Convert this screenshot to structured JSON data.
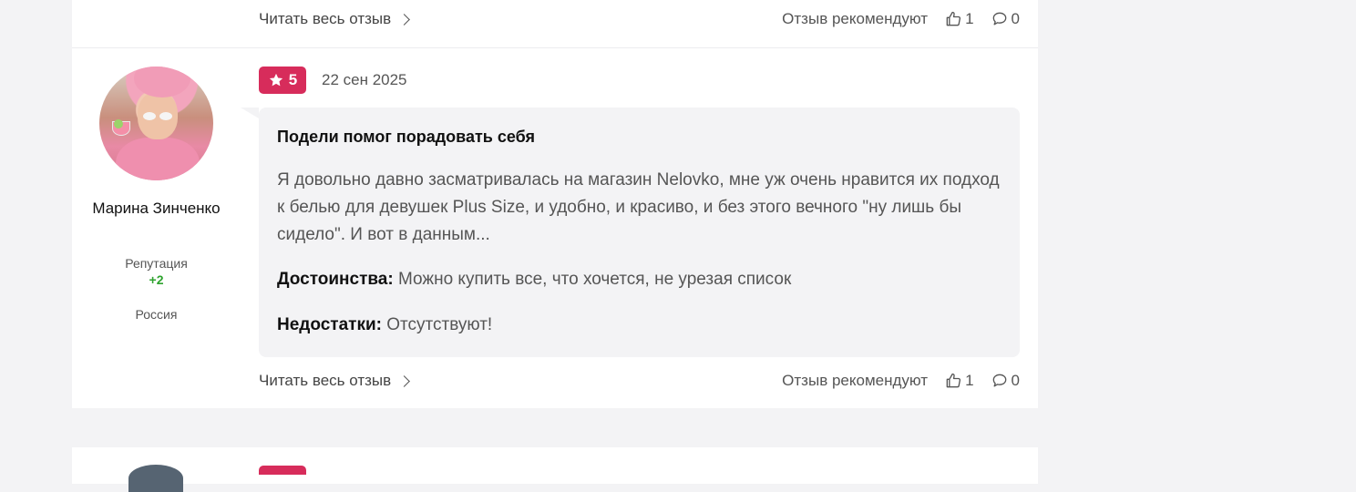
{
  "colors": {
    "accent": "#d72c5b",
    "reputation": "#2ea32e",
    "bubble": "#f3f3f5"
  },
  "prev_review": {
    "read_more": "Читать весь отзыв",
    "recommend_label": "Отзыв рекомендуют",
    "likes": "1",
    "comments": "0"
  },
  "review": {
    "author": {
      "name": "Марина Зинченко",
      "reputation_label": "Репутация",
      "reputation_value": "+2",
      "country": "Россия"
    },
    "rating": "5",
    "date": "22 сен 2025",
    "title": "Подели помог порадовать себя",
    "text": "Я довольно давно засматривалась на магазин Nelovko, мне уж очень нравится их подход к белью для девушек Plus Size, и удобно, и красиво, и без этого вечного \"ну лишь бы сидело\". И вот в данным...",
    "pros_label": "Достоинства:",
    "pros": "Можно купить все, что хочется, не урезая список",
    "cons_label": "Недостатки:",
    "cons": "Отсутствуют!",
    "read_more": "Читать весь отзыв",
    "recommend_label": "Отзыв рекомендуют",
    "likes": "1",
    "comments": "0"
  },
  "icons": {
    "star": "star-icon",
    "like": "thumbs-up-icon",
    "comment": "comment-icon",
    "chevron": "chevron-right-icon"
  }
}
